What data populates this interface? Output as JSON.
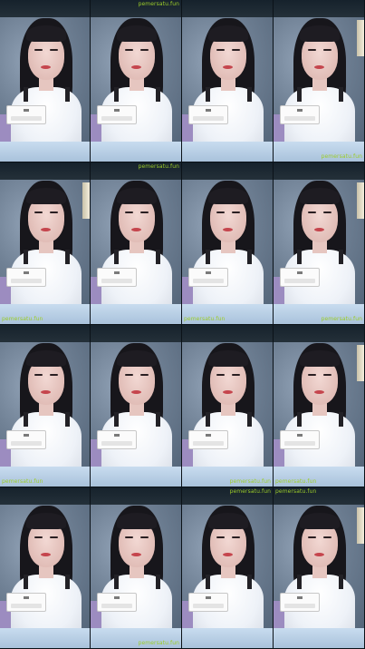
{
  "watermark": "pemersatu.fun",
  "frames": [
    {
      "row": 0,
      "col": 0
    },
    {
      "row": 0,
      "col": 1
    },
    {
      "row": 0,
      "col": 2
    },
    {
      "row": 0,
      "col": 3
    },
    {
      "row": 1,
      "col": 0
    },
    {
      "row": 1,
      "col": 1
    },
    {
      "row": 1,
      "col": 2
    },
    {
      "row": 1,
      "col": 3
    },
    {
      "row": 2,
      "col": 0
    },
    {
      "row": 2,
      "col": 1
    },
    {
      "row": 2,
      "col": 2
    },
    {
      "row": 2,
      "col": 3
    },
    {
      "row": 3,
      "col": 0
    },
    {
      "row": 3,
      "col": 1
    },
    {
      "row": 3,
      "col": 2
    },
    {
      "row": 3,
      "col": 3
    }
  ],
  "watermarks": [
    {
      "frame": 1,
      "pos": "top-right"
    },
    {
      "frame": 3,
      "pos": "bottom-right"
    },
    {
      "frame": 5,
      "pos": "top-right"
    },
    {
      "frame": 4,
      "pos": "bottom-left"
    },
    {
      "frame": 6,
      "pos": "bottom-left"
    },
    {
      "frame": 7,
      "pos": "bottom-right"
    },
    {
      "frame": 8,
      "pos": "bottom-left"
    },
    {
      "frame": 10,
      "pos": "bottom-right"
    },
    {
      "frame": 11,
      "pos": "bottom-left"
    },
    {
      "frame": 13,
      "pos": "bottom-right"
    },
    {
      "frame": 14,
      "pos": "top-right"
    },
    {
      "frame": 15,
      "pos": "top-left"
    }
  ],
  "colors": {
    "watermark": "#9ccc2a",
    "popup": "#fbfbfb",
    "shirt": "#ffffff",
    "hair": "#17161b",
    "lips": "#c5454d",
    "background": "#0d1820"
  }
}
